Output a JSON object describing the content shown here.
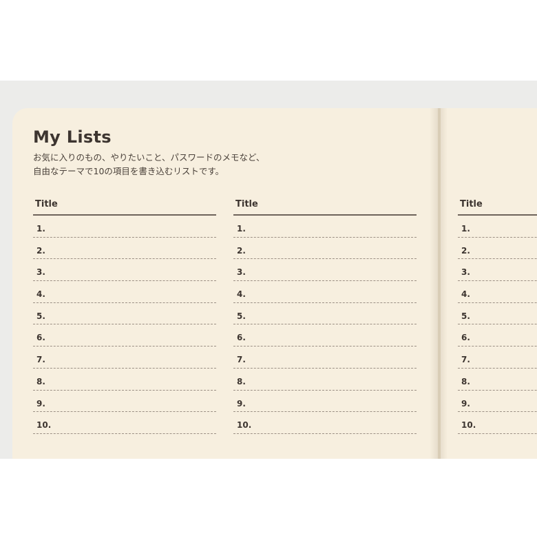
{
  "page": {
    "title": "My Lists",
    "description_line1": "お気に入りのもの、やりたいこと、パスワードのメモなど、",
    "description_line2": "自由なテーマで10の項目を書き込むリストです。"
  },
  "lists": [
    {
      "header": "Title",
      "items": [
        "1.",
        "2.",
        "3.",
        "4.",
        "5.",
        "6.",
        "7.",
        "8.",
        "9.",
        "10."
      ]
    },
    {
      "header": "Title",
      "items": [
        "1.",
        "2.",
        "3.",
        "4.",
        "5.",
        "6.",
        "7.",
        "8.",
        "9.",
        "10."
      ]
    },
    {
      "header": "Title",
      "items": [
        "1.",
        "2.",
        "3.",
        "4.",
        "5.",
        "6.",
        "7.",
        "8.",
        "9.",
        "10."
      ]
    }
  ],
  "colors": {
    "paper": "#f7efdf",
    "backdrop": "#ececea",
    "ink": "#3d3530"
  }
}
